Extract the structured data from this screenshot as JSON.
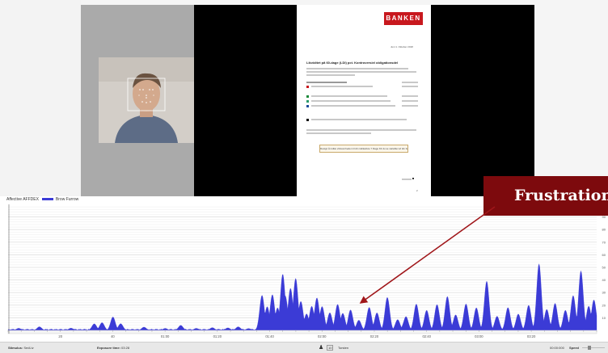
{
  "slide": {
    "logo": "BANKEN",
    "date": "Juni 1. Oktober 2018",
    "heading": "Likviditet på 60-dage (LDI) pct. Kontroversiel obligationsdel",
    "button_text": "Design å indlæ virksomheden til din indikativte 7 Dage  Kil du se variabler af din bogsøg",
    "page_number": "2"
  },
  "callout": {
    "text": "Frustration",
    "color": "#7d0a0d"
  },
  "chart_data": {
    "type": "area",
    "title": "",
    "legend": [
      {
        "name": "Affective AFFDEX",
        "color": ""
      },
      {
        "name": "Brow Furrow",
        "color": "#3b3bd6"
      }
    ],
    "ylim": [
      0,
      100
    ],
    "y_ticks": [
      "10",
      "20",
      "30",
      "40",
      "50",
      "60",
      "70",
      "80",
      "90"
    ],
    "x_ticks": [
      "20",
      "40",
      "01:00",
      "01:20",
      "01:40",
      "02:00",
      "02:20",
      "02:40",
      "03:00",
      "03:20"
    ],
    "xlim_seconds": [
      0,
      225
    ],
    "series": [
      {
        "name": "Brow Furrow",
        "color": "#3b3bd6",
        "peaks": [
          {
            "t": 4,
            "v": 2
          },
          {
            "t": 12,
            "v": 3
          },
          {
            "t": 24,
            "v": 2
          },
          {
            "t": 33,
            "v": 6
          },
          {
            "t": 36,
            "v": 9
          },
          {
            "t": 40,
            "v": 15
          },
          {
            "t": 43,
            "v": 6
          },
          {
            "t": 52,
            "v": 3
          },
          {
            "t": 60,
            "v": 2
          },
          {
            "t": 66,
            "v": 4
          },
          {
            "t": 72,
            "v": 2
          },
          {
            "t": 78,
            "v": 3
          },
          {
            "t": 84,
            "v": 2
          },
          {
            "t": 88,
            "v": 3
          },
          {
            "t": 92,
            "v": 2
          },
          {
            "t": 97,
            "v": 38
          },
          {
            "t": 99,
            "v": 22
          },
          {
            "t": 101,
            "v": 30
          },
          {
            "t": 103,
            "v": 18
          },
          {
            "t": 105,
            "v": 45
          },
          {
            "t": 106,
            "v": 28
          },
          {
            "t": 108,
            "v": 37
          },
          {
            "t": 110,
            "v": 52
          },
          {
            "t": 112,
            "v": 35
          },
          {
            "t": 114,
            "v": 22
          },
          {
            "t": 116,
            "v": 26
          },
          {
            "t": 118,
            "v": 30
          },
          {
            "t": 120,
            "v": 20
          },
          {
            "t": 123,
            "v": 14
          },
          {
            "t": 126,
            "v": 22
          },
          {
            "t": 128,
            "v": 16
          },
          {
            "t": 131,
            "v": 25
          },
          {
            "t": 134,
            "v": 12
          },
          {
            "t": 138,
            "v": 20
          },
          {
            "t": 141,
            "v": 14
          },
          {
            "t": 145,
            "v": 28
          },
          {
            "t": 149,
            "v": 12
          },
          {
            "t": 152,
            "v": 18
          },
          {
            "t": 156,
            "v": 24
          },
          {
            "t": 160,
            "v": 16
          },
          {
            "t": 164,
            "v": 22
          },
          {
            "t": 168,
            "v": 38
          },
          {
            "t": 171,
            "v": 20
          },
          {
            "t": 175,
            "v": 24
          },
          {
            "t": 179,
            "v": 18
          },
          {
            "t": 183,
            "v": 42
          },
          {
            "t": 187,
            "v": 16
          },
          {
            "t": 191,
            "v": 26
          },
          {
            "t": 195,
            "v": 14
          },
          {
            "t": 199,
            "v": 20
          },
          {
            "t": 203,
            "v": 60
          },
          {
            "t": 206,
            "v": 24
          },
          {
            "t": 209,
            "v": 34
          },
          {
            "t": 213,
            "v": 18
          },
          {
            "t": 216,
            "v": 28
          },
          {
            "t": 219,
            "v": 48
          },
          {
            "t": 222,
            "v": 22
          },
          {
            "t": 224,
            "v": 32
          }
        ]
      }
    ]
  },
  "status_bar": {
    "stimulus_label": "Stimulus:",
    "stimulus_value": "SedLiv",
    "exposure_label": "Exposure time:",
    "exposure_value": "03:28",
    "respondent": "Torsten",
    "respondent_id": "10",
    "timecode": "00:00:000",
    "speed_label": "Speed"
  }
}
